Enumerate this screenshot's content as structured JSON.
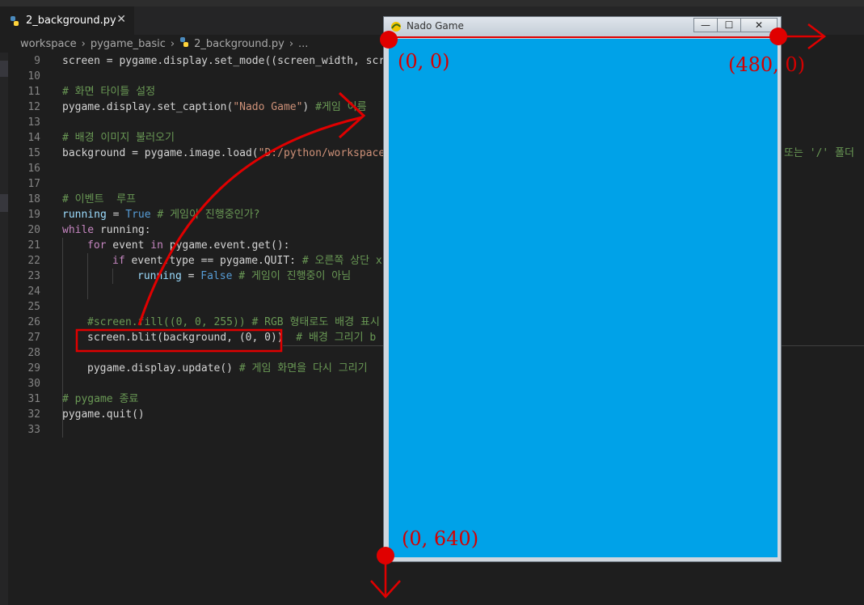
{
  "tab": {
    "label": "2_background.py",
    "close": "✕"
  },
  "breadcrumb": [
    "workspace",
    "pygame_basic",
    "2_background.py",
    "..."
  ],
  "code_lines": [
    {
      "n": "9"
    },
    {
      "n": "10"
    },
    {
      "n": "11"
    },
    {
      "n": "12"
    },
    {
      "n": "13"
    },
    {
      "n": "14"
    },
    {
      "n": "15"
    },
    {
      "n": "16"
    },
    {
      "n": "17"
    },
    {
      "n": "18"
    },
    {
      "n": "19"
    },
    {
      "n": "20"
    },
    {
      "n": "21"
    },
    {
      "n": "22"
    },
    {
      "n": "23"
    },
    {
      "n": "24"
    },
    {
      "n": "25"
    },
    {
      "n": "26"
    },
    {
      "n": "27"
    },
    {
      "n": "28"
    },
    {
      "n": "29"
    },
    {
      "n": "30"
    },
    {
      "n": "31"
    },
    {
      "n": "32"
    },
    {
      "n": "33"
    }
  ],
  "code": {
    "l9_a": "screen = pygame.display.set_mode((screen_width, scre",
    "l11": "# 화면 타이틀 설정",
    "l12_a": "pygame.display.set_caption(",
    "l12_b": "\"Nado Game\"",
    "l12_c": ") ",
    "l12_d": "#게임 이름",
    "l14": "# 배경 이미지 불러오기",
    "l15_a": "background = pygame.image.load(",
    "l15_b": "\"D:/python/workspace/",
    "l15_c": "또는 '/' 폴더",
    "l18": "# 이벤트  루프",
    "l19_a": "running",
    "l19_b": " = ",
    "l19_c": "True",
    "l19_d": " # 게임이 진행중인가?",
    "l20_a": "while",
    "l20_b": " running:",
    "l21_a": "for",
    "l21_b": " event ",
    "l21_c": "in",
    "l21_d": " pygame.event.get():",
    "l22_a": "if",
    "l22_b": " event.type == pygame.QUIT: ",
    "l22_c": "# 오른쪽 상단 x",
    "l23_a": "running",
    "l23_b": " = ",
    "l23_c": "False",
    "l23_d": " # 게임이 진행중이 아님",
    "l26": "#screen.fill((0, 0, 255)) # RGB 형태로도 배경 표시",
    "l27_a": "screen.blit(background, (0, 0))",
    "l27_b": "  # 배경 그리기 b",
    "l29_a": "pygame.display.update() ",
    "l29_b": "# 게임 화면을 다시 그리기",
    "l31": "# pygame 종료",
    "l32": "pygame.quit()"
  },
  "game_window": {
    "title": "Nado Game",
    "minimize": "—",
    "maximize": "☐",
    "close": "✕",
    "background_color": "#00a2e8"
  },
  "annotations": {
    "top_left": "(0, 0)",
    "top_right": "(480, 0)",
    "bottom_left": "(0, 640)",
    "color": "#e00000"
  }
}
